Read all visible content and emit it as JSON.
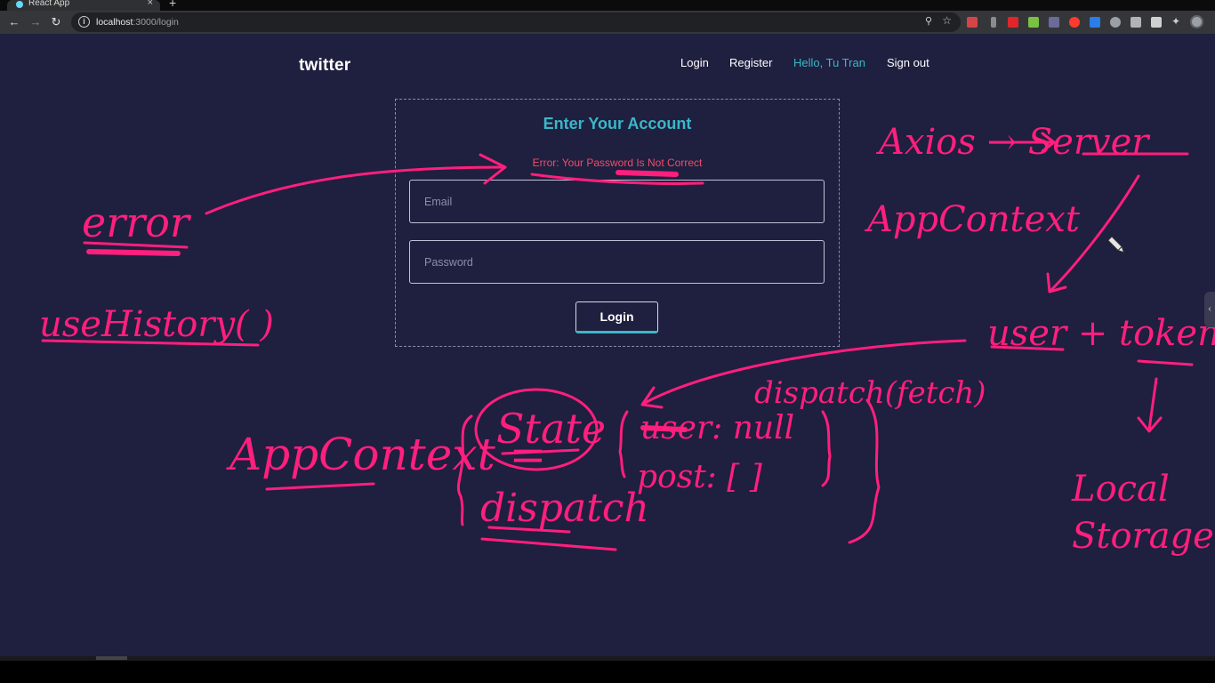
{
  "browser": {
    "tab_title": "React App",
    "tab_close": "×",
    "new_tab": "+",
    "url_host": "localhost",
    "url_path": ":3000/login"
  },
  "navbar": {
    "logo": "twitter",
    "links": [
      "Login",
      "Register",
      "Hello, Tu Tran",
      "Sign out"
    ]
  },
  "login": {
    "title": "Enter Your Account",
    "error": "Error: Your Password Is Not Correct",
    "email_placeholder": "Email",
    "password_placeholder": "Password",
    "button": "Login"
  },
  "annotations": {
    "color": "#ff1f7d",
    "texts": [
      "error",
      "useHistory( )",
      "Axios → Server",
      "AppContext",
      "user + token",
      "dispatch(fetch)",
      "Local",
      "Storage",
      "AppContext =",
      "State",
      "dispatch",
      "user: null",
      "post: [ ]"
    ]
  },
  "colors": {
    "page_bg": "#1f1f3f",
    "accent": "#3ab7c9",
    "error": "#f04d6a"
  }
}
